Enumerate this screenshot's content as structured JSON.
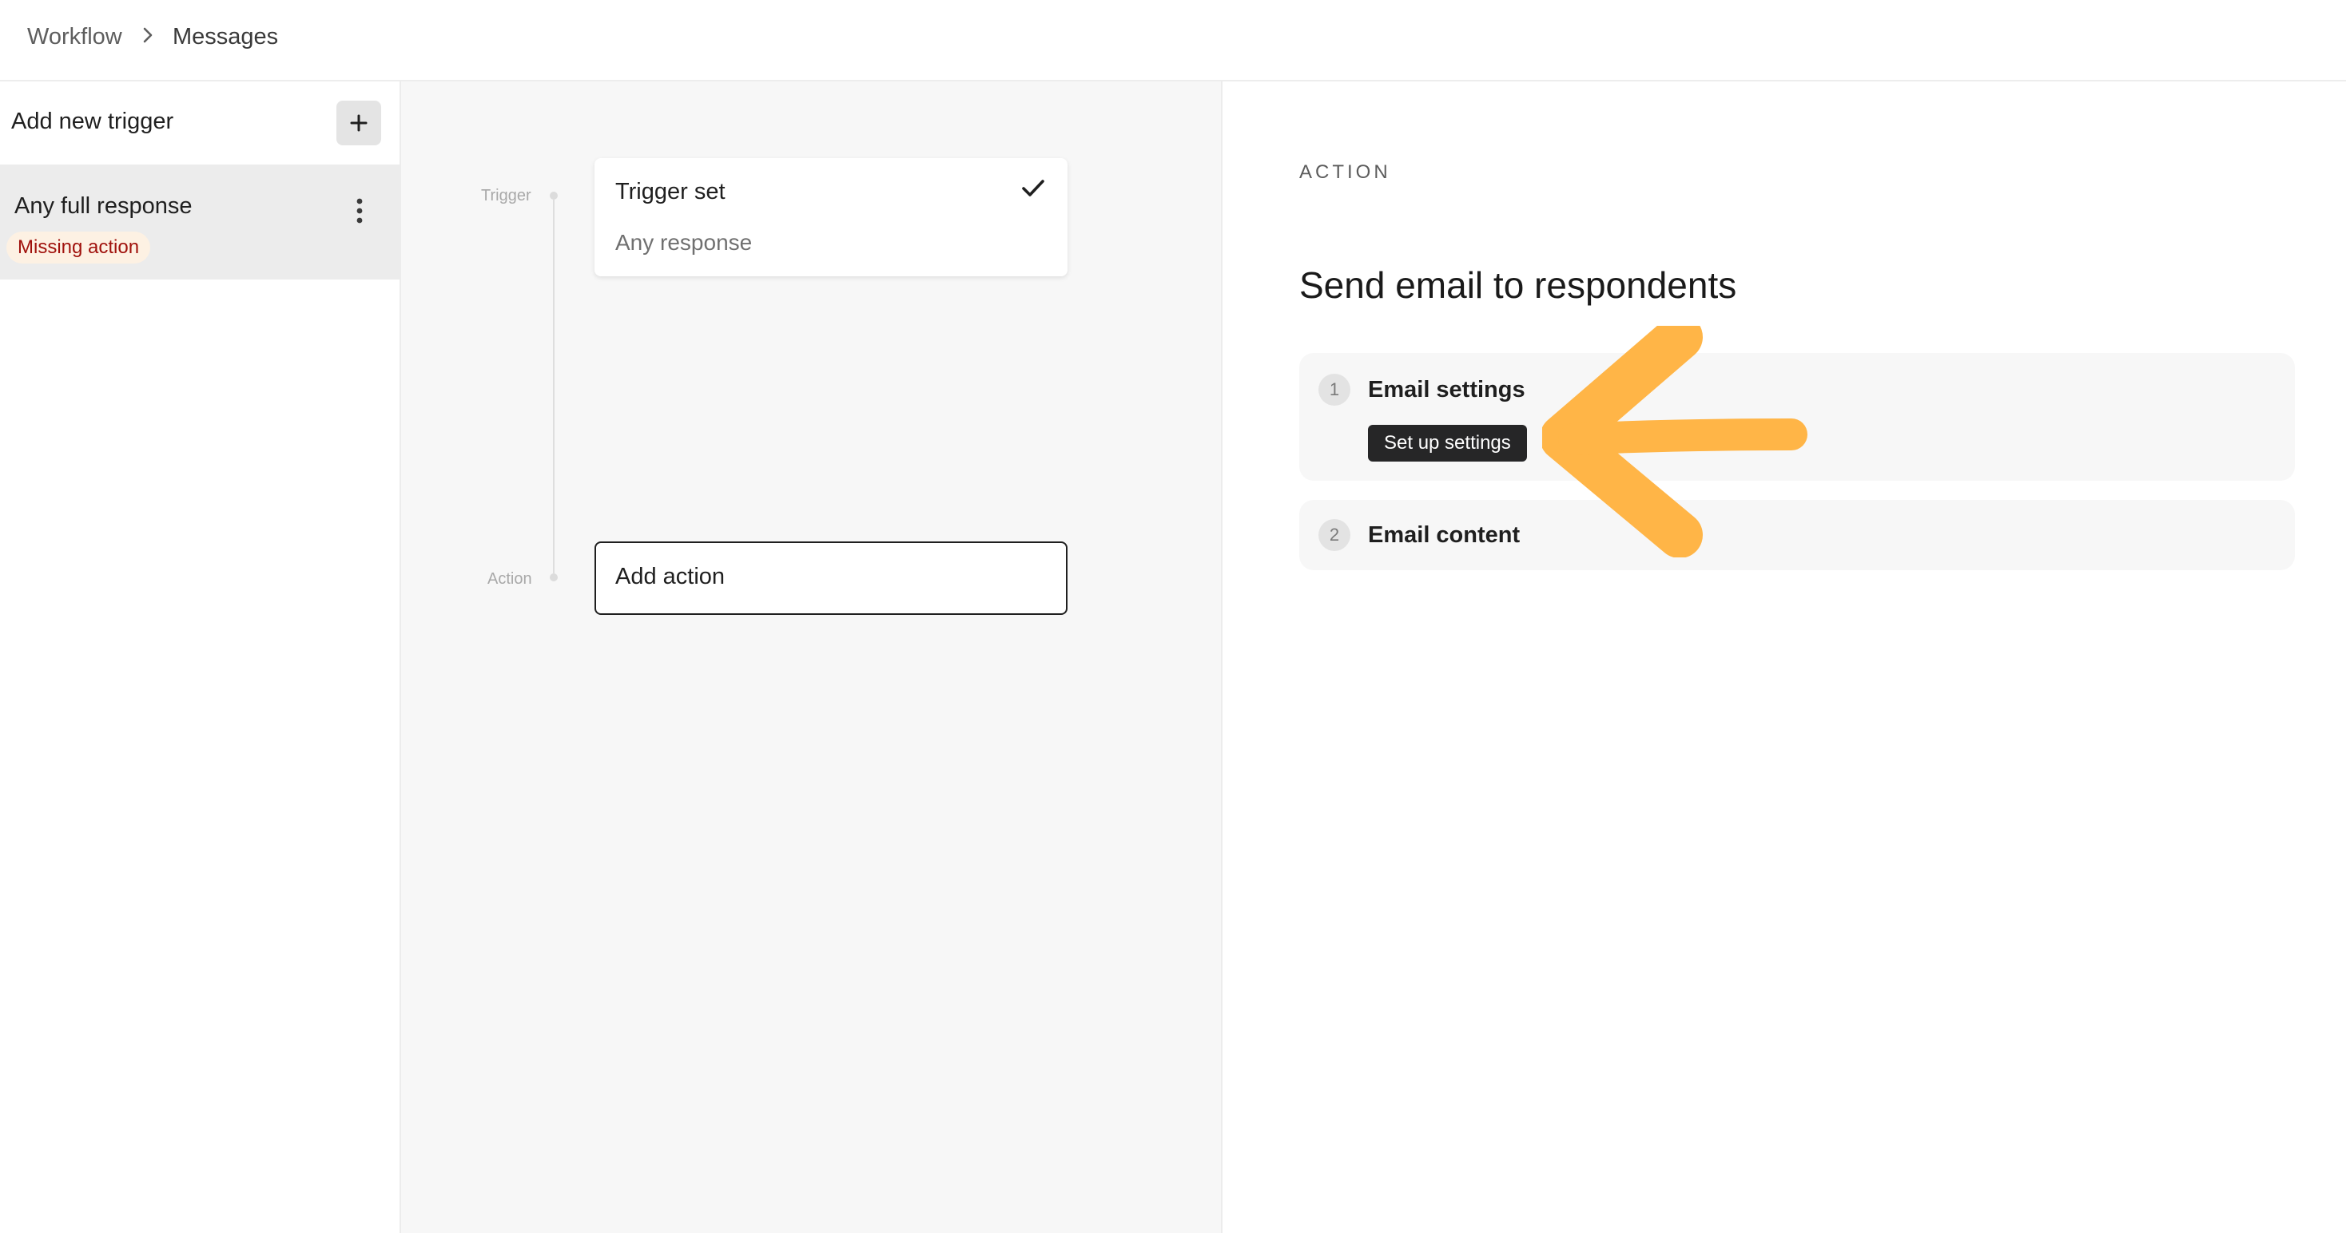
{
  "breadcrumb": {
    "items": [
      "Workflow",
      "Messages"
    ]
  },
  "sidebar": {
    "add_trigger_label": "Add new trigger",
    "items": [
      {
        "title": "Any full response",
        "badge": "Missing action"
      }
    ]
  },
  "canvas": {
    "trigger_label": "Trigger",
    "action_label": "Action",
    "trigger_card": {
      "title": "Trigger set",
      "subtitle": "Any response"
    },
    "action_card": {
      "label": "Add action"
    }
  },
  "panel": {
    "eyebrow": "ACTION",
    "title": "Send email to respondents",
    "steps": [
      {
        "number": "1",
        "title": "Email settings",
        "button": "Set up settings"
      },
      {
        "number": "2",
        "title": "Email content"
      }
    ]
  },
  "icons": {
    "breadcrumb_separator": "chevron-right-icon",
    "add": "plus-icon",
    "more": "kebab-icon",
    "done": "check-icon",
    "annotation": "arrow-left-icon"
  },
  "colors": {
    "badge_text": "#a0110c",
    "badge_bg": "#fdf1e3",
    "button_dark": "#262627",
    "annotation_arrow": "#ffb547"
  }
}
